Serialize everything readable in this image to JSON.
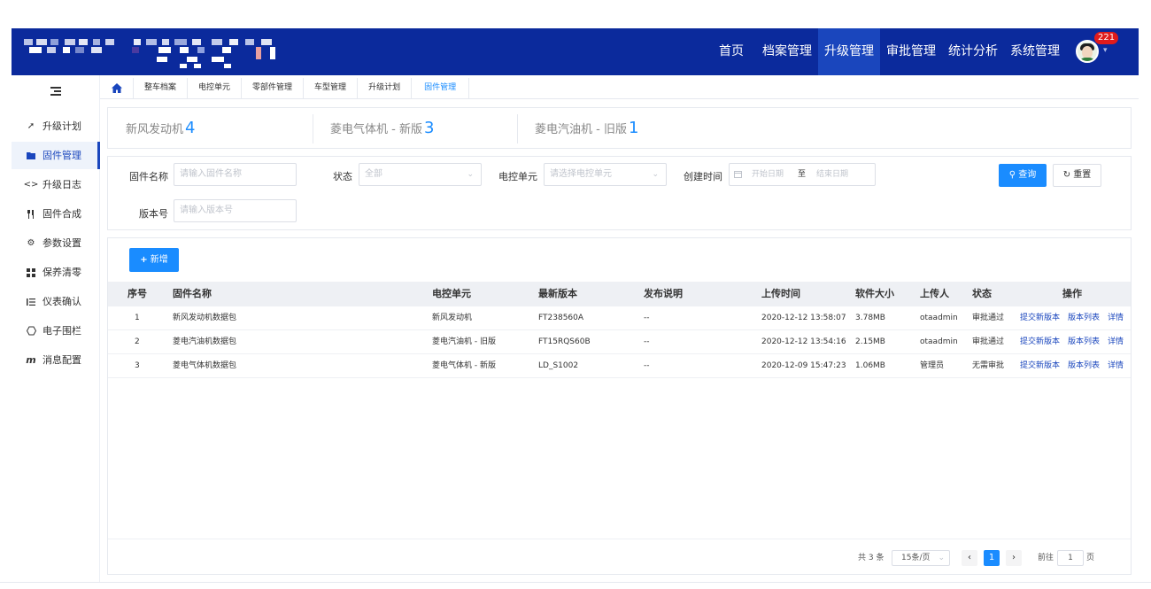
{
  "header": {
    "nav": [
      {
        "label": "首页",
        "active": false
      },
      {
        "label": "档案管理",
        "active": false
      },
      {
        "label": "升级管理",
        "active": true
      },
      {
        "label": "审批管理",
        "active": false
      },
      {
        "label": "统计分析",
        "active": false
      },
      {
        "label": "系统管理",
        "active": false
      }
    ],
    "notification_count": "221",
    "colors": {
      "bar": "#0b2a9c",
      "active": "#1a46bd"
    }
  },
  "sidebar": {
    "items": [
      {
        "label": "升级计划",
        "icon": "send-icon",
        "active": false
      },
      {
        "label": "固件管理",
        "icon": "folder-icon",
        "active": true
      },
      {
        "label": "升级日志",
        "icon": "code-icon",
        "active": false
      },
      {
        "label": "固件合成",
        "icon": "utensils-icon",
        "active": false
      },
      {
        "label": "参数设置",
        "icon": "gear-icon",
        "active": false
      },
      {
        "label": "保养清零",
        "icon": "grid-icon",
        "active": false
      },
      {
        "label": "仪表确认",
        "icon": "list-icon",
        "active": false
      },
      {
        "label": "电子围栏",
        "icon": "fence-icon",
        "active": false
      },
      {
        "label": "消息配置",
        "icon": "m-icon",
        "active": false
      }
    ]
  },
  "tabs": [
    {
      "label": "整车档案",
      "active": false
    },
    {
      "label": "电控单元",
      "active": false
    },
    {
      "label": "零部件管理",
      "active": false
    },
    {
      "label": "车型管理",
      "active": false
    },
    {
      "label": "升级计划",
      "active": false
    },
    {
      "label": "固件管理",
      "active": true
    }
  ],
  "summary": [
    {
      "label": "新风发动机",
      "count": "4"
    },
    {
      "label": "菱电气体机 - 新版",
      "count": "3"
    },
    {
      "label": "菱电汽油机 - 旧版",
      "count": "1"
    }
  ],
  "filters": {
    "name_label": "固件名称",
    "name_placeholder": "请输入固件名称",
    "status_label": "状态",
    "status_value": "全部",
    "ecu_label": "电控单元",
    "ecu_placeholder": "请选择电控单元",
    "created_label": "创建时间",
    "start_placeholder": "开始日期",
    "range_sep": "至",
    "end_placeholder": "结束日期",
    "version_label": "版本号",
    "version_placeholder": "请输入版本号",
    "search_label": "查询",
    "reset_label": "重置"
  },
  "table": {
    "add_label": "新增",
    "columns": [
      "序号",
      "固件名称",
      "电控单元",
      "最新版本",
      "发布说明",
      "上传时间",
      "软件大小",
      "上传人",
      "状态",
      "操作"
    ],
    "rows": [
      {
        "idx": "1",
        "name": "新风发动机数据包",
        "ecu": "新风发动机",
        "version": "FT238560A",
        "note": "--",
        "time": "2020-12-12 13:58:07",
        "size": "3.78MB",
        "uploader": "otaadmin",
        "status": "审批通过"
      },
      {
        "idx": "2",
        "name": "菱电汽油机数据包",
        "ecu": "菱电汽油机 - 旧版",
        "version": "FT15RQS60B",
        "note": "--",
        "time": "2020-12-12 13:54:16",
        "size": "2.15MB",
        "uploader": "otaadmin",
        "status": "审批通过"
      },
      {
        "idx": "3",
        "name": "菱电气体机数据包",
        "ecu": "菱电气体机 - 新版",
        "version": "LD_S1002",
        "note": "--",
        "time": "2020-12-09 15:47:23",
        "size": "1.06MB",
        "uploader": "管理员",
        "status": "无需审批"
      }
    ],
    "actions": [
      "提交新版本",
      "版本列表",
      "详情"
    ]
  },
  "pager": {
    "total": "共 3 条",
    "page_size": "15条/页",
    "current_page": "1",
    "goto_label": "前往",
    "goto_value": "1",
    "page_unit": "页"
  }
}
